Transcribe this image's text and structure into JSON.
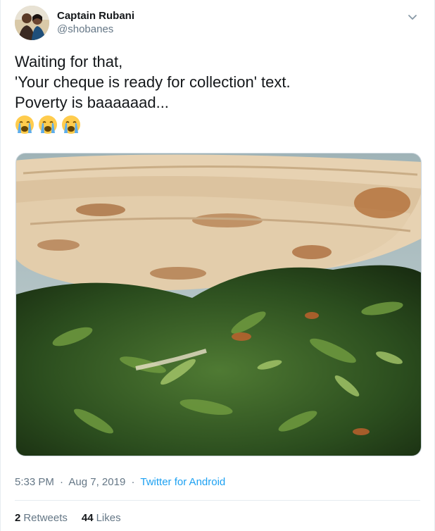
{
  "author": {
    "display_name": "Captain Rubani",
    "handle": "@shobanes",
    "avatar_icon": "profile-photo"
  },
  "tweet": {
    "lines": [
      "Waiting for that,",
      "'Your cheque is ready for collection' text.",
      "Poverty is baaaaaad..."
    ],
    "emojis": [
      "crying-face-emoji",
      "crying-face-emoji",
      "crying-face-emoji"
    ]
  },
  "media": {
    "alt_icon": "photo-chapati-and-greens"
  },
  "meta": {
    "time": "5:33 PM",
    "separator": "·",
    "date": "Aug 7, 2019",
    "source": "Twitter for Android"
  },
  "stats": {
    "retweets_count": "2",
    "retweets_label": "Retweets",
    "likes_count": "44",
    "likes_label": "Likes"
  },
  "colors": {
    "link": "#1da1f2",
    "secondary_text": "#657786",
    "primary_text": "#14171a"
  }
}
